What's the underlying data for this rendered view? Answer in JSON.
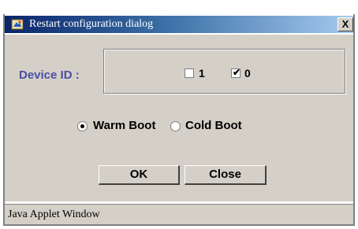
{
  "window": {
    "title": "Restart configuration dialog",
    "close_label": "X"
  },
  "device": {
    "label": "Device ID :",
    "options": [
      {
        "label": "1",
        "checked": false
      },
      {
        "label": "0",
        "checked": true
      }
    ],
    "check_mark": "✔"
  },
  "boot": {
    "options": [
      {
        "label": "Warm Boot",
        "selected": true
      },
      {
        "label": "Cold Boot",
        "selected": false
      }
    ]
  },
  "buttons": {
    "ok_label": "OK",
    "close_label": "Close"
  },
  "status": {
    "text": "Java Applet Window"
  },
  "colors": {
    "title_bar_start": "#0a246a",
    "title_bar_end": "#a6caf0",
    "dialog_bg": "#d4d0c8",
    "label_color": "#4a4ea0"
  }
}
